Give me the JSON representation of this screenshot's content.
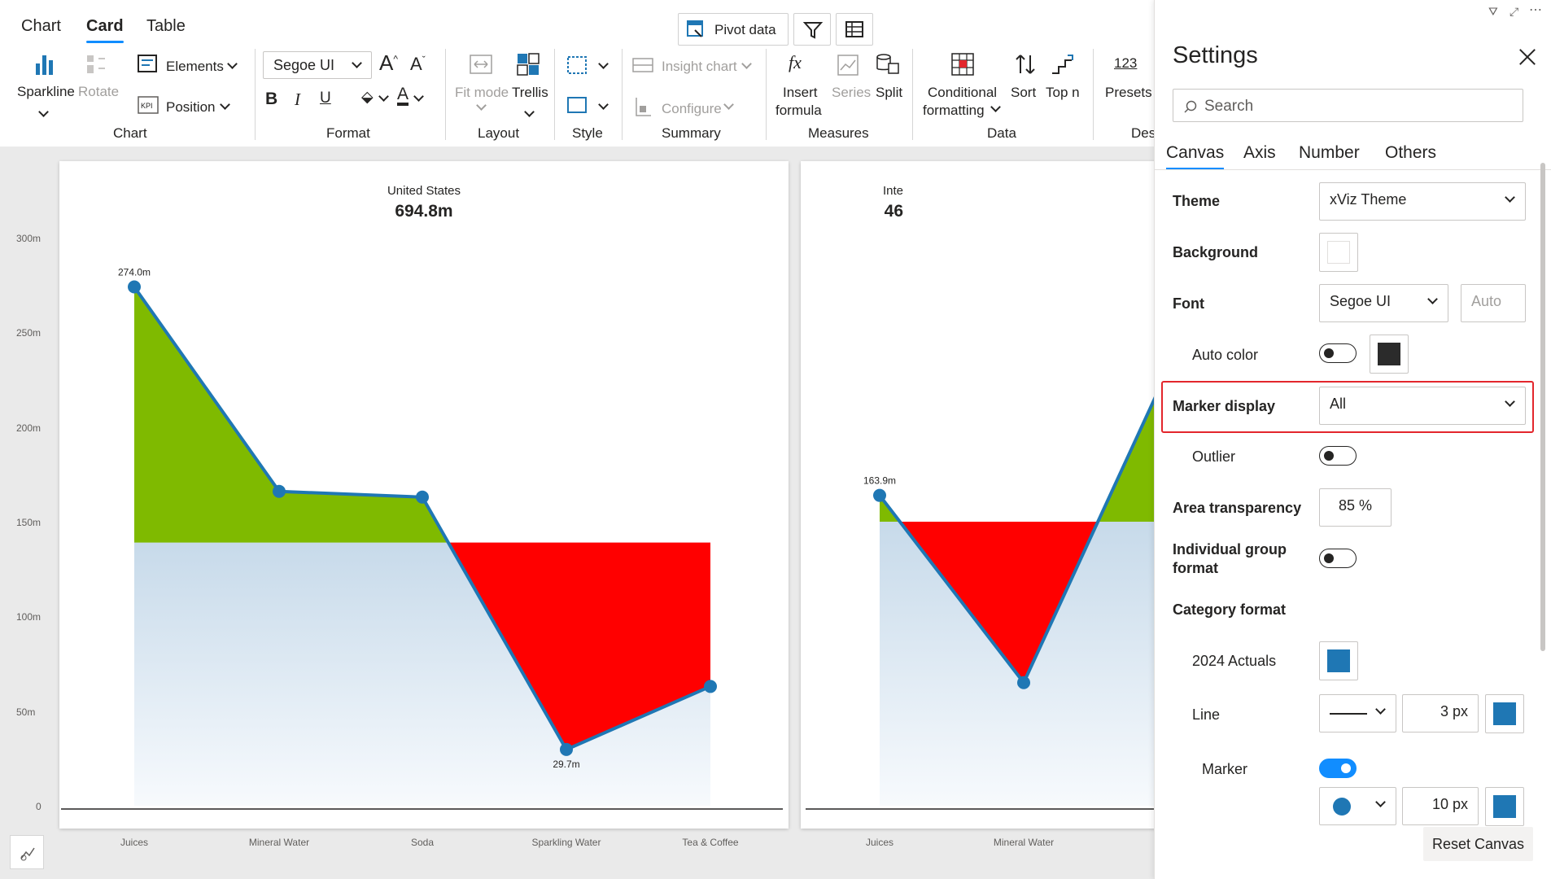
{
  "ribbon": {
    "tabs": [
      "Chart",
      "Card",
      "Table"
    ],
    "active_tab": "Card",
    "pivot_label": "Pivot data",
    "chart_group": {
      "sparkline": "Sparkline",
      "rotate": "Rotate",
      "label": "Chart"
    },
    "elements": {
      "elements": "Elements",
      "position": "Position"
    },
    "format": {
      "font": "Segoe UI",
      "label": "Format"
    },
    "layout": {
      "fit_mode": "Fit mode",
      "trellis": "Trellis",
      "label": "Layout"
    },
    "style": {
      "label": "Style"
    },
    "summary": {
      "insight_chart": "Insight chart",
      "configure": "Configure",
      "label": "Summary"
    },
    "measures": {
      "insert_formula_1": "Insert",
      "insert_formula_2": "formula",
      "series": "Series",
      "split": "Split",
      "label": "Measures"
    },
    "data": {
      "conditional_1": "Conditional",
      "conditional_2": "formatting",
      "sort": "Sort",
      "top_n": "Top n",
      "label": "Data"
    },
    "presets": {
      "icon_text": "123",
      "label": "Presets",
      "group_partial": "Des"
    }
  },
  "cards": [
    {
      "title": "United States",
      "value": "694.8m"
    },
    {
      "title": "Inte",
      "value": "46"
    }
  ],
  "y_axis": {
    "ticks": [
      "300m",
      "250m",
      "200m",
      "150m",
      "100m",
      "50m",
      "0"
    ]
  },
  "chart_data": [
    {
      "type": "line",
      "title": "United States",
      "subtitle": "694.8m",
      "categories": [
        "Juices",
        "Mineral Water",
        "Soda",
        "Sparkling Water",
        "Tea & Coffee"
      ],
      "series": [
        {
          "values": [
            274.0,
            166,
            163,
            29.7,
            63
          ]
        }
      ],
      "reference": 139,
      "data_labels": [
        "274.0m",
        "",
        "",
        "29.7m",
        ""
      ],
      "ylim": [
        0,
        300
      ],
      "y_unit": "m",
      "positive_color": "#7fba00",
      "negative_color": "#ff0000",
      "line_color": "#1f77b4"
    },
    {
      "type": "line",
      "title": "Inte",
      "categories": [
        "Juices",
        "Mineral Water"
      ],
      "series": [
        {
          "values": [
            163.9,
            65,
            230
          ]
        }
      ],
      "reference": 150,
      "data_labels": [
        "163.9m",
        "",
        ""
      ],
      "ylim": [
        0,
        180
      ],
      "positive_color": "#7fba00",
      "line_color": "#1f77b4"
    }
  ],
  "settings": {
    "title": "Settings",
    "search_placeholder": "Search",
    "tabs": [
      "Canvas",
      "Axis",
      "Number",
      "Others"
    ],
    "theme_label": "Theme",
    "theme_value": "xViz Theme",
    "background_label": "Background",
    "font_label": "Font",
    "font_value": "Segoe UI",
    "font_size": "Auto",
    "auto_color_label": "Auto color",
    "auto_color_swatch": "#2b2b2b",
    "marker_display_label": "Marker display",
    "marker_display_value": "All",
    "outlier_label": "Outlier",
    "area_transparency_label": "Area transparency",
    "area_transparency_value": "85 %",
    "individual_group_label_1": "Individual group",
    "individual_group_label_2": "format",
    "category_format_label": "Category format",
    "actuals_label": "2024 Actuals",
    "actuals_color": "#1f77b4",
    "line_label": "Line",
    "line_width": "3 px",
    "marker_label": "Marker",
    "marker_size": "10 px",
    "reset_label": "Reset Canvas"
  }
}
